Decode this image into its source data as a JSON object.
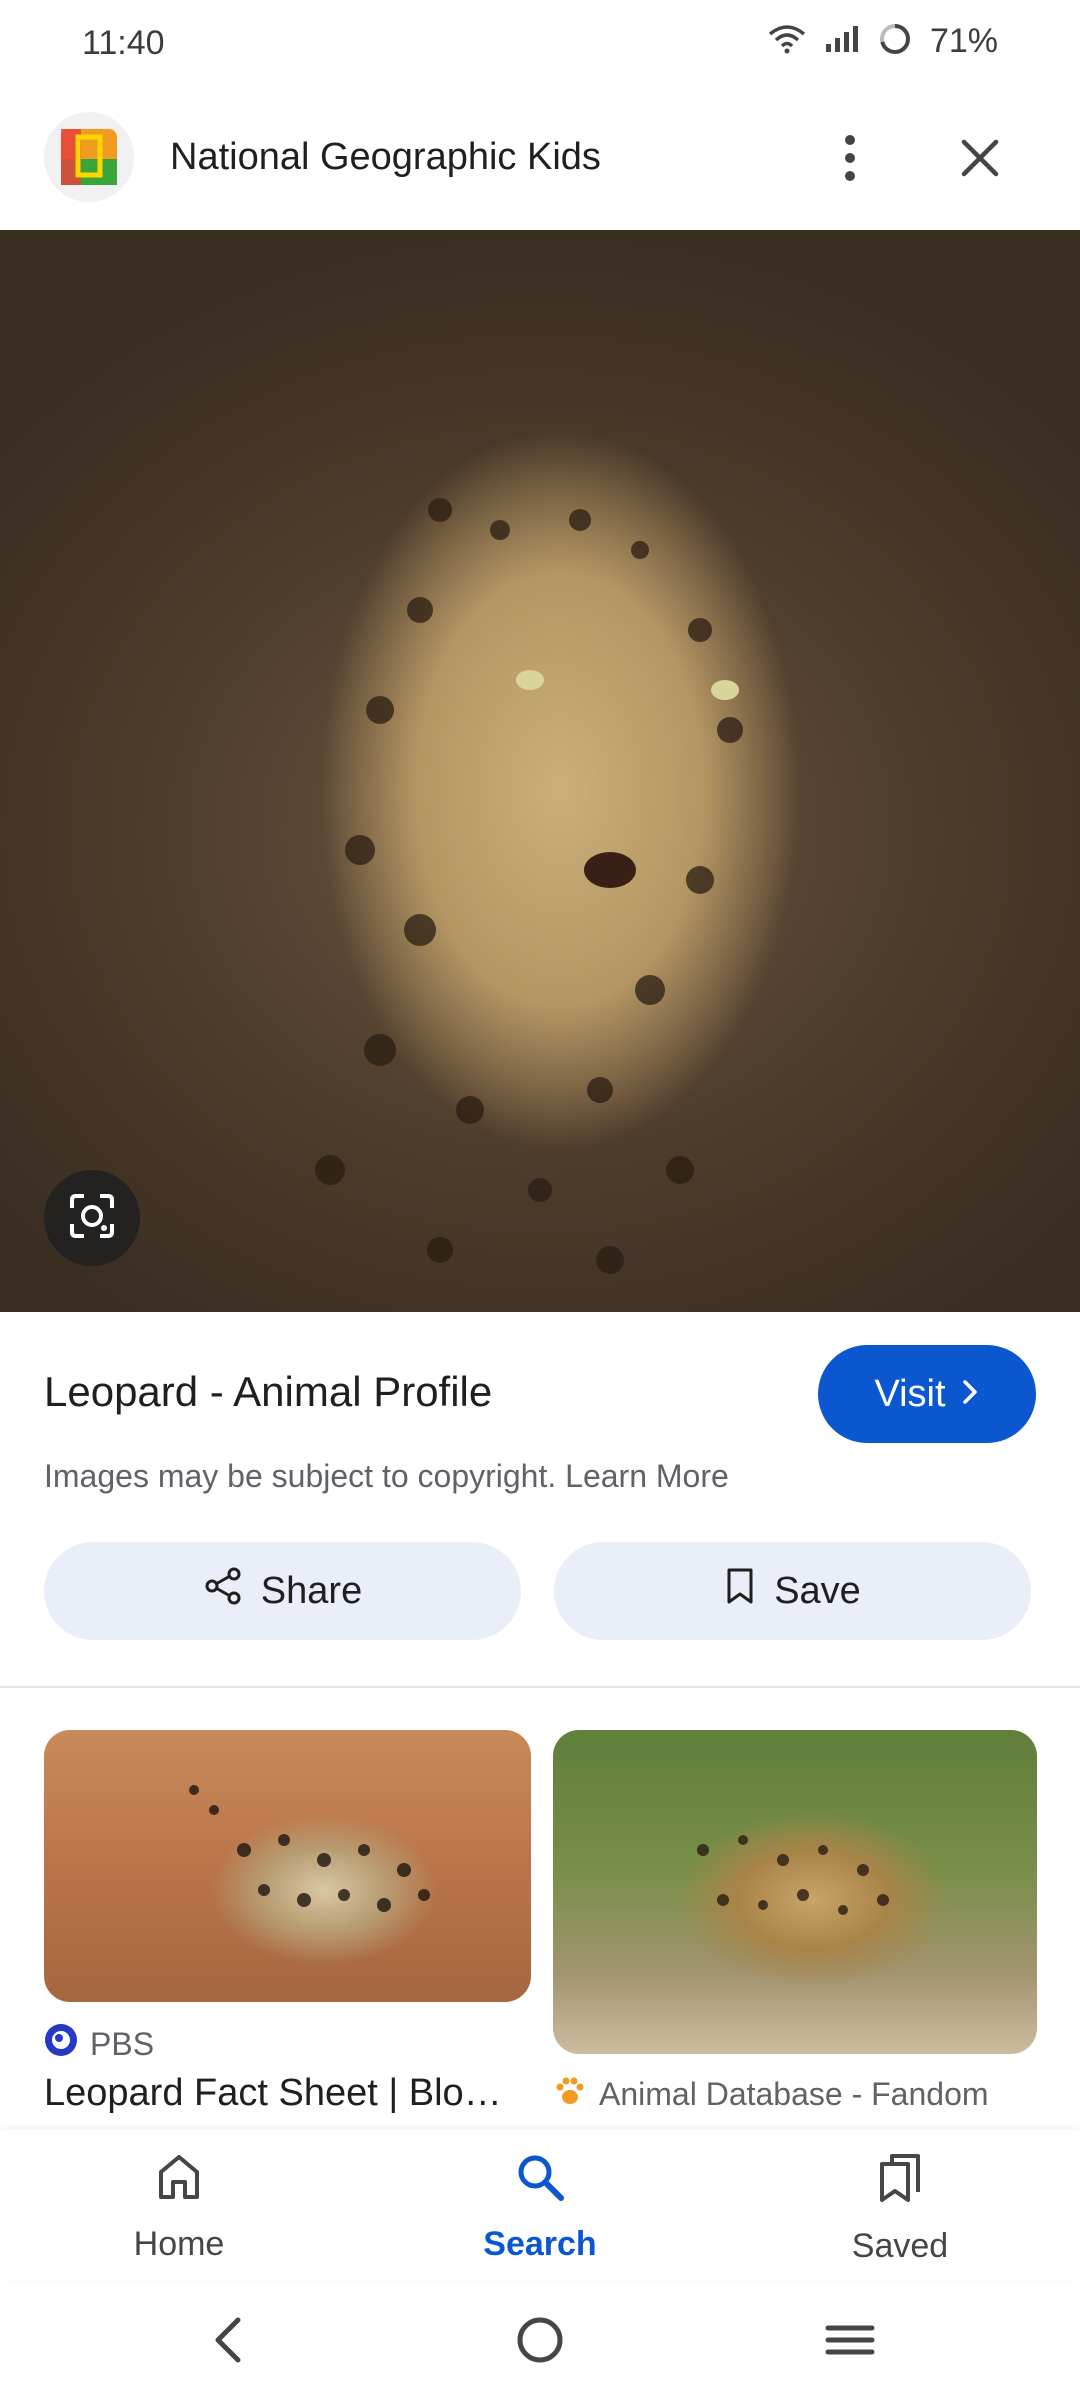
{
  "status_bar": {
    "time": "11:40",
    "battery": "71%"
  },
  "app_bar": {
    "site_name": "National Geographic Kids"
  },
  "result": {
    "title": "Leopard - Animal Profile",
    "visit_label": "Visit",
    "copyright_note": "Images may be subject to copyright. Learn More",
    "share_label": "Share",
    "save_label": "Save"
  },
  "related": [
    {
      "source": "PBS",
      "title": "Leopard Fact Sheet | Blog..."
    },
    {
      "source": "Animal Database - Fandom"
    }
  ],
  "bottom_nav": {
    "items": [
      {
        "label": "Home"
      },
      {
        "label": "Search"
      },
      {
        "label": "Saved"
      }
    ],
    "active": "Search"
  },
  "colors": {
    "accent": "#0b57d0",
    "pill_bg": "#e9eef9"
  },
  "icons": [
    "wifi-icon",
    "signal-icon",
    "battery-icon",
    "more-vert-icon",
    "close-icon",
    "lens-icon",
    "chevron-right-icon",
    "share-icon",
    "bookmark-icon",
    "pbs-icon",
    "paw-icon",
    "home-icon",
    "search-icon",
    "saved-icon",
    "back-icon",
    "home-circle-icon",
    "recents-icon"
  ]
}
